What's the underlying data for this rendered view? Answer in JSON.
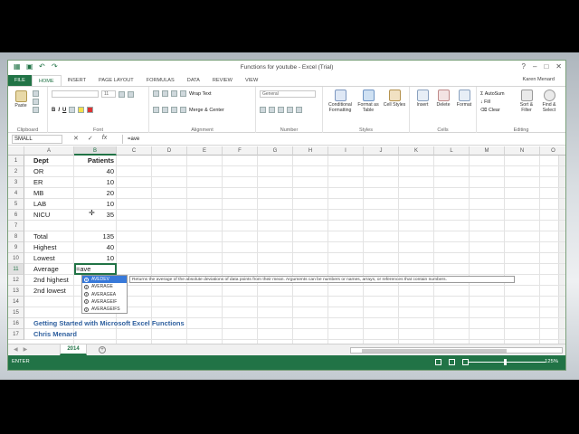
{
  "window": {
    "title": "Functions for youtube - Excel (Trial)",
    "user": "Karen Menard"
  },
  "tabs": [
    "FILE",
    "HOME",
    "INSERT",
    "PAGE LAYOUT",
    "FORMULAS",
    "DATA",
    "REVIEW",
    "VIEW"
  ],
  "ribbon": {
    "clipboard": {
      "label": "Clipboard",
      "paste": "Paste"
    },
    "font": {
      "label": "Font",
      "size": "11"
    },
    "alignment": {
      "label": "Alignment",
      "wrap": "Wrap Text",
      "merge": "Merge & Center"
    },
    "number": {
      "label": "Number",
      "format": "General"
    },
    "styles": {
      "label": "Styles",
      "cond": "Conditional Formatting",
      "fmt_table": "Format as Table",
      "cell_styles": "Cell Styles"
    },
    "cells": {
      "label": "Cells",
      "insert": "Insert",
      "delete": "Delete",
      "format": "Format"
    },
    "editing": {
      "label": "Editing",
      "autosum": "AutoSum",
      "fill": "Fill",
      "clear": "Clear",
      "sort": "Sort & Filter",
      "find": "Find & Select"
    }
  },
  "formula_bar": {
    "name_box": "SMALL",
    "formula": "=ave",
    "fx": "fx"
  },
  "columns": [
    "A",
    "B",
    "C",
    "D",
    "E",
    "F",
    "G",
    "H",
    "I",
    "J",
    "K",
    "L",
    "M",
    "N",
    "O"
  ],
  "rows": [
    "1",
    "2",
    "3",
    "4",
    "5",
    "6",
    "7",
    "8",
    "9",
    "10",
    "11",
    "12",
    "13",
    "14",
    "15",
    "16",
    "17"
  ],
  "cells": {
    "A1": "Dept",
    "B1": "Patients",
    "A2": "OR",
    "B2": "40",
    "A3": "ER",
    "B3": "10",
    "A4": "MB",
    "B4": "20",
    "A5": "LAB",
    "B5": "10",
    "A6": "NICU",
    "B6": "35",
    "A8": "Total",
    "B8": "135",
    "A9": "Highest",
    "B9": "40",
    "A10": "Lowest",
    "B10": "10",
    "A11": "Average",
    "B11": "=ave",
    "A12": "2nd highest",
    "A13": "2nd lowest",
    "A16": "Getting Started with Microsoft Excel Functions",
    "A17": "Chris Menard"
  },
  "autocomplete": {
    "items": [
      "AVEDEV",
      "AVERAGE",
      "AVERAGEA",
      "AVERAGEIF",
      "AVERAGEIFS"
    ],
    "selected": 0,
    "tooltip": "Returns the average of the absolute deviations of data points from their mean. Arguments can be numbers or names, arrays, or references that contain numbers."
  },
  "sheet": {
    "active_tab": "2014"
  },
  "status": {
    "mode": "ENTER",
    "zoom": "125%"
  },
  "colors": {
    "accent": "#217346",
    "title_text": "#2e5f9e",
    "selection": "#3879d9"
  }
}
